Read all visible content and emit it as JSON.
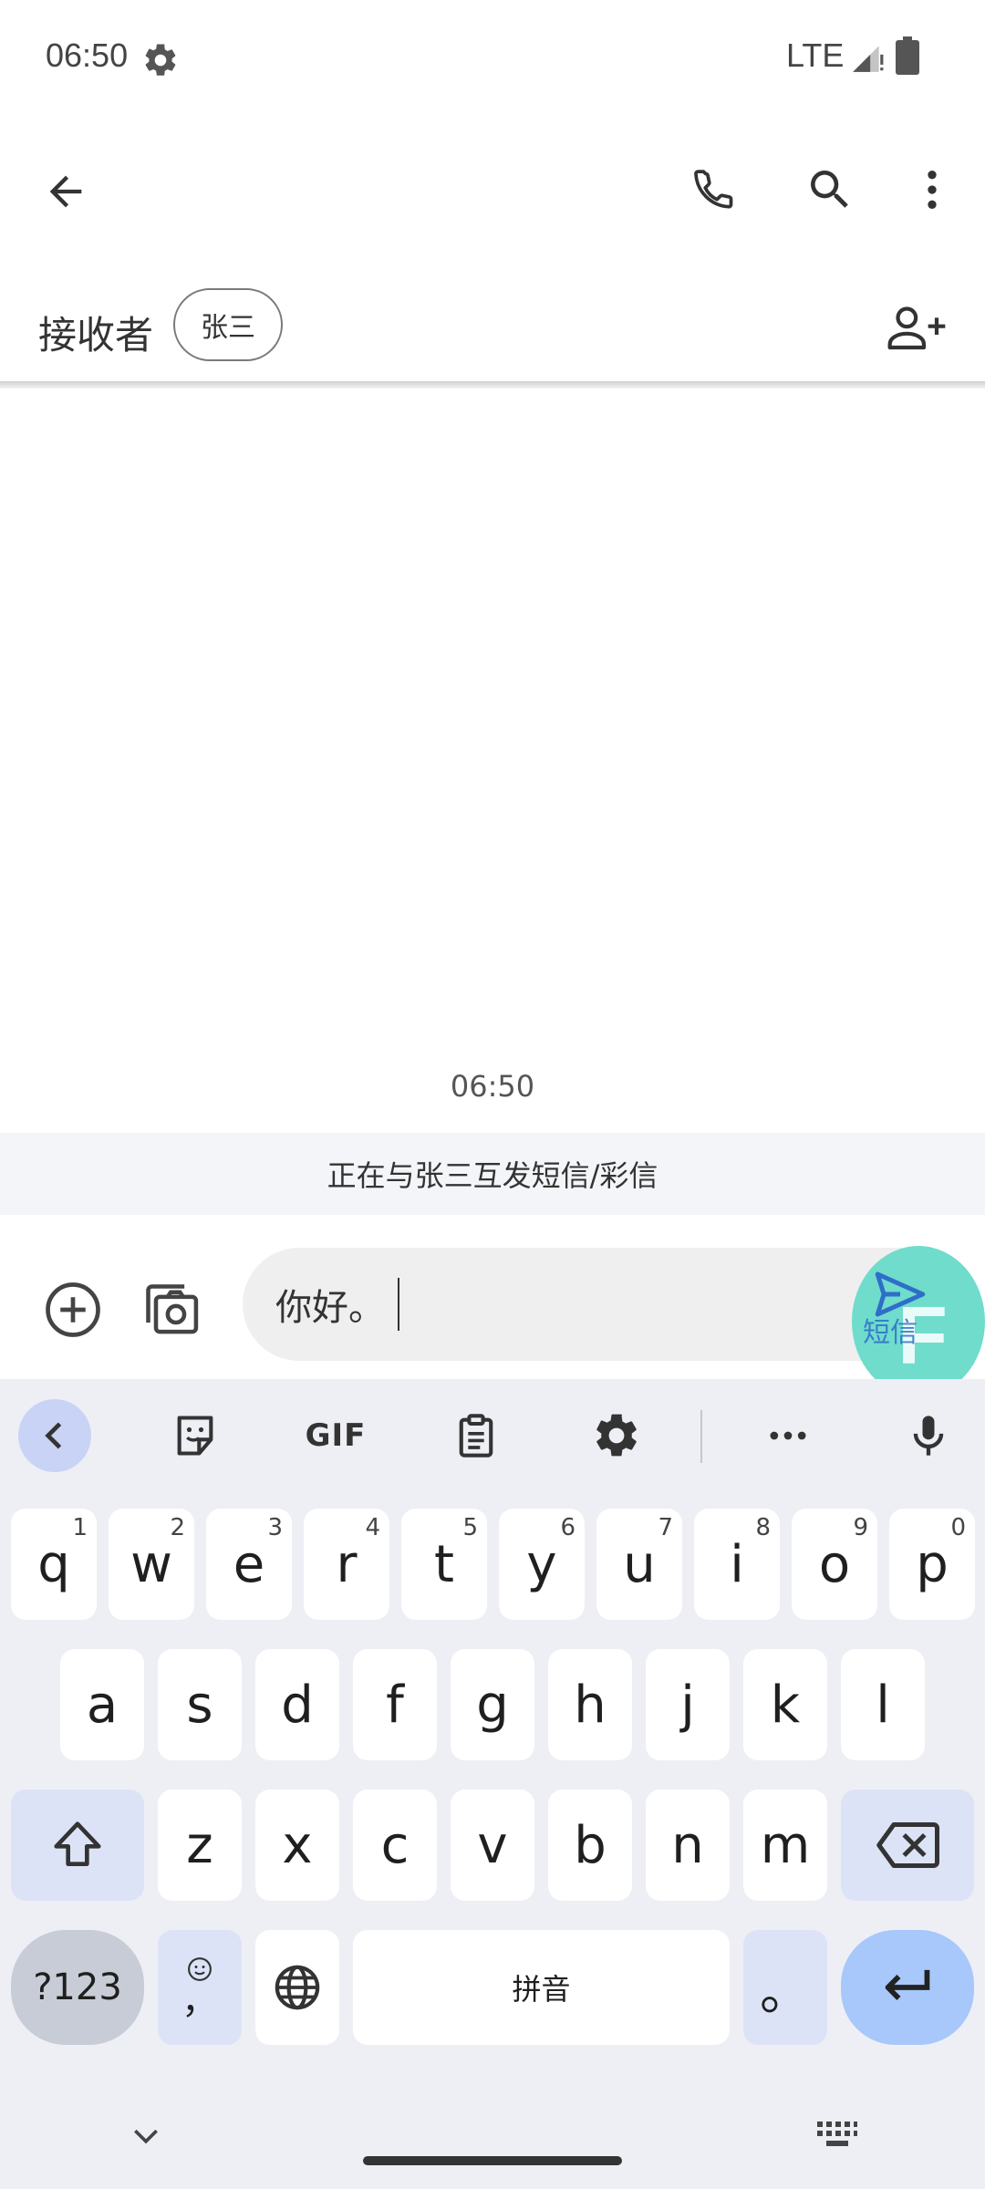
{
  "status_bar": {
    "time": "06:50",
    "network": "LTE",
    "icons": [
      "gear-icon",
      "signal-icon",
      "battery-icon"
    ]
  },
  "app_bar": {
    "icons": [
      "back-arrow-icon",
      "phone-icon",
      "search-icon",
      "more-vert-icon"
    ]
  },
  "recipients": {
    "label": "接收者",
    "chips": [
      "张三"
    ],
    "add_icon": "person-add-icon"
  },
  "conversation": {
    "timestamp": "06:50",
    "banner": "正在与张三互发短信/彩信"
  },
  "compose": {
    "text": "你好。",
    "send_label": "短信",
    "attach_icon": "add-circle-icon",
    "gallery_icon": "gallery-camera-icon",
    "send_icon": "send-icon",
    "accent_color": "#6fdccc"
  },
  "keyboard": {
    "toolbar": {
      "gif_label": "GIF",
      "icons": [
        "chevron-left-icon",
        "sticker-icon",
        "clipboard-icon",
        "settings-icon",
        "more-horiz-icon",
        "mic-icon"
      ]
    },
    "row1": [
      {
        "label": "q",
        "hint": "1"
      },
      {
        "label": "w",
        "hint": "2"
      },
      {
        "label": "e",
        "hint": "3"
      },
      {
        "label": "r",
        "hint": "4"
      },
      {
        "label": "t",
        "hint": "5"
      },
      {
        "label": "y",
        "hint": "6"
      },
      {
        "label": "u",
        "hint": "7"
      },
      {
        "label": "i",
        "hint": "8"
      },
      {
        "label": "o",
        "hint": "9"
      },
      {
        "label": "p",
        "hint": "0"
      }
    ],
    "row2": [
      "a",
      "s",
      "d",
      "f",
      "g",
      "h",
      "j",
      "k",
      "l"
    ],
    "row3": [
      "z",
      "x",
      "c",
      "v",
      "b",
      "n",
      "m"
    ],
    "row4": {
      "symbols": "?123",
      "emoji_comma": "，",
      "space": "拼音",
      "period": "。"
    },
    "accent_color": "#a8c7fa"
  }
}
